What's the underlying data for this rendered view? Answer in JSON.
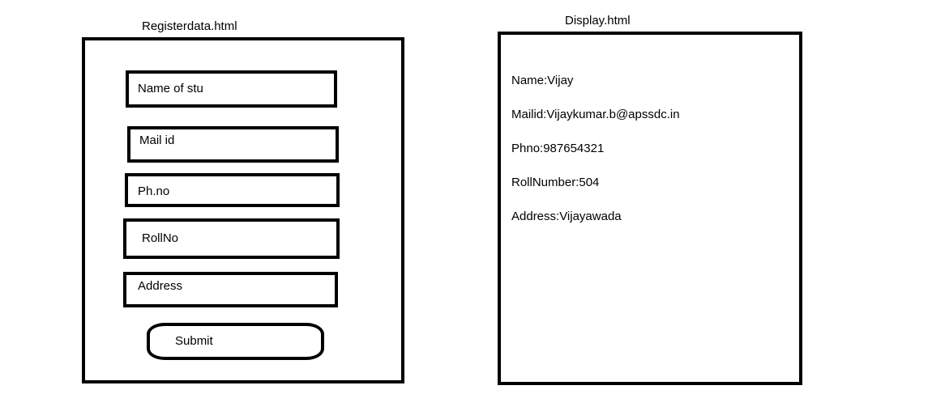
{
  "register_page": {
    "title": "Registerdata.html",
    "fields": [
      {
        "label": "Name of stu"
      },
      {
        "label": "Mail id"
      },
      {
        "label": "Ph.no"
      },
      {
        "label": "RollNo"
      },
      {
        "label": "Address"
      }
    ],
    "submit_label": "Submit"
  },
  "display_page": {
    "title": "Display.html",
    "lines": [
      "Name:Vijay",
      "Mailid:Vijaykumar.b@apssdc.in",
      "Phno:987654321",
      "RollNumber:504",
      "Address:Vijayawada"
    ]
  }
}
